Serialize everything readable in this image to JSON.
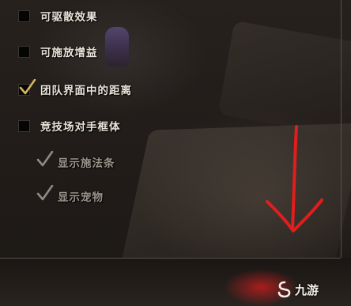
{
  "options": [
    {
      "label": "可驱散效果",
      "checked": false,
      "enabled": true
    },
    {
      "label": "可施放增益",
      "checked": false,
      "enabled": true
    },
    {
      "label": "团队界面中的距离",
      "checked": true,
      "enabled": true
    },
    {
      "label": "竞技场对手框体",
      "checked": false,
      "enabled": true
    },
    {
      "label": "显示施法条",
      "checked": true,
      "enabled": false
    },
    {
      "label": "显示宠物",
      "checked": true,
      "enabled": false
    }
  ],
  "annotation": {
    "color": "#e11d1d",
    "icon": "arrow-down-icon"
  },
  "watermark": {
    "text": "九游",
    "icon": "logo-mark-icon"
  },
  "colors": {
    "check": "#d6b55a",
    "check_dim": "#8f8a84",
    "label": "#e9e4da",
    "label_dim": "#9c958c"
  }
}
